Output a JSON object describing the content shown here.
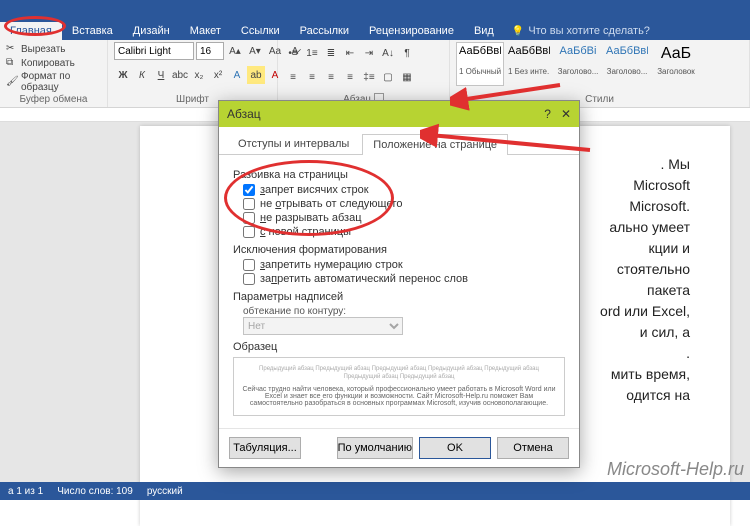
{
  "tabs": {
    "items": [
      "Главная",
      "Вставка",
      "Дизайн",
      "Макет",
      "Ссылки",
      "Рассылки",
      "Рецензирование",
      "Вид"
    ],
    "active": 0,
    "tell_me": "Что вы хотите сделать?"
  },
  "clipboard": {
    "cut": "Вырезать",
    "copy": "Копировать",
    "format_painter": "Формат по образцу",
    "group_label": "Буфер обмена"
  },
  "font": {
    "name": "Calibri Light",
    "size": "16",
    "group_label": "Шрифт"
  },
  "paragraph": {
    "group_label": "Абзац"
  },
  "styles": {
    "group_label": "Стили",
    "items": [
      {
        "preview": "АаБбВвГг,",
        "name": "1 Обычный",
        "color": "#333"
      },
      {
        "preview": "АаБбВвГг,",
        "name": "1 Без инте...",
        "color": "#333"
      },
      {
        "preview": "АаБбВі",
        "name": "Заголово...",
        "color": "#2e74b5"
      },
      {
        "preview": "АаБбВвГ",
        "name": "Заголово...",
        "color": "#2e74b5"
      },
      {
        "preview": "АаБ",
        "name": "Заголовок",
        "color": "#333"
      }
    ]
  },
  "document_lines": [
    ". Мы",
    "Microsoft",
    "Microsoft.",
    "ально умеет",
    "кции и",
    "стоятельно",
    "пакета",
    "ord или Excel,",
    "и сил, а",
    ".",
    "мить время,",
    "одится на"
  ],
  "dialog": {
    "title": "Абзац",
    "tabs": [
      "Отступы и интервалы",
      "Положение на странице"
    ],
    "active_tab": 1,
    "sections": {
      "pagination": "Разбивка на страницы",
      "exceptions": "Исключения форматирования",
      "textbox": "Параметры надписей",
      "preview": "Образец"
    },
    "pagination_opts": [
      {
        "label": "запрет висячих строк",
        "checked": true,
        "u": "з"
      },
      {
        "label": "не отрывать от следующего",
        "checked": false,
        "u": "о"
      },
      {
        "label": "не разрывать абзац",
        "checked": false,
        "u": "н"
      },
      {
        "label": "с новой страницы",
        "checked": false,
        "u": "с"
      }
    ],
    "exception_opts": [
      {
        "label": "запретить нумерацию строк",
        "checked": false,
        "u": "з"
      },
      {
        "label": "запретить автоматический перенос слов",
        "checked": false,
        "u": "п"
      }
    ],
    "wrap_label": "обтекание по контуру:",
    "wrap_value": "Нет",
    "preview_blurb": "Сейчас трудно найти человека, который профессионально умеет работать в Microsoft Word или Excel и знает все его функции и возможности. Сайт Microsoft-Help.ru поможет Вам самостоятельно разобраться в основных программах Microsoft, изучив основополагающие.",
    "buttons": {
      "tabs": "Табуляция...",
      "default": "По умолчанию",
      "ok": "OK",
      "cancel": "Отмена"
    }
  },
  "statusbar": {
    "page": "а 1 из 1",
    "words": "Число слов: 109",
    "lang": "русский"
  },
  "watermark": "Microsoft-Help.ru"
}
